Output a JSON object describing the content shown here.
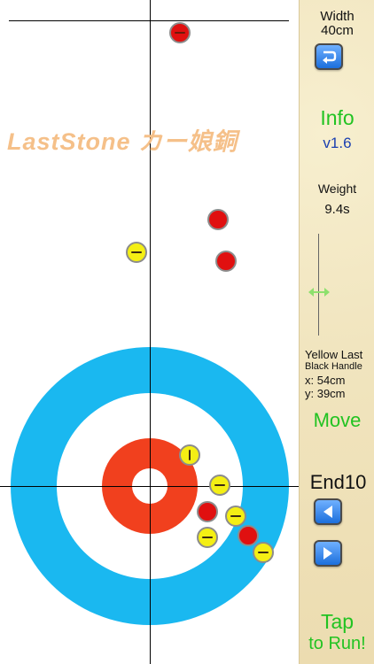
{
  "app_title": "LastStone カー娘銅",
  "sidebar": {
    "width_label": "Width",
    "width_value": "40cm",
    "info_label": "Info",
    "version": "v1.6",
    "weight_label": "Weight",
    "weight_value": "9.4s",
    "slider_icon": "double-arrow-icon",
    "status_line1": "Yellow Last",
    "status_line2": "Black Handle",
    "coord_x": "x: 54cm",
    "coord_y": "y: 39cm",
    "move_label": "Move",
    "end_label": "End10",
    "run_line1": "Tap",
    "run_line2": "to Run!"
  },
  "colors": {
    "red_stone": "#e01010",
    "yellow_stone": "#f4ef14",
    "house_outer": "#1ab8f0",
    "house_button": "#f1401e",
    "accent_green": "#22c322",
    "version_blue": "#1a3fb0"
  }
}
